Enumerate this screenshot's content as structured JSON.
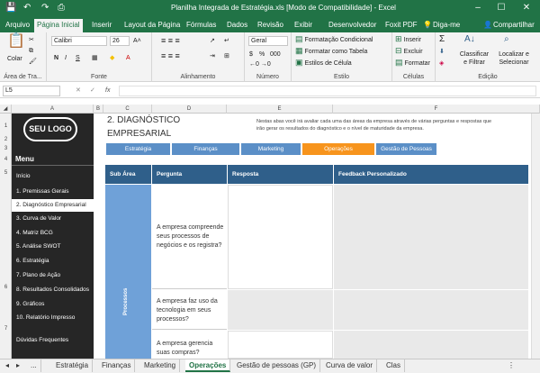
{
  "window": {
    "title": "Planilha Integrada de Estratégia.xls  [Modo de Compatibilidade] - Excel",
    "minimize": "–",
    "maximize": "☐",
    "close": "✕"
  },
  "ribbon_tabs": [
    "Arquivo",
    "Página Inicial",
    "Inserir",
    "Layout da Página",
    "Fórmulas",
    "Dados",
    "Revisão",
    "Exibir",
    "Desenvolvedor",
    "Foxit PDF",
    "Diga-me",
    "Compartilhar"
  ],
  "ribbon": {
    "clipboard": {
      "paste": "Colar",
      "label": "Área de Tra..."
    },
    "font": {
      "name": "Calibri",
      "size": "26",
      "bold": "N",
      "italic": "I",
      "underline": "S",
      "label": "Fonte"
    },
    "alignment": {
      "label": "Alinhamento"
    },
    "number": {
      "format": "Geral",
      "label": "Número",
      "percent": "%",
      "thousands": "000"
    },
    "styles": {
      "conditional": "Formatação Condicional",
      "table": "Formatar como Tabela",
      "cell": "Estilos de Célula",
      "label": "Estilo"
    },
    "cells": {
      "insert": "Inserir",
      "delete": "Excluir",
      "format": "Formatar",
      "label": "Células"
    },
    "editing": {
      "sort": "Classificar e Filtrar",
      "find": "Localizar e Selecionar",
      "label": "Edição"
    }
  },
  "formula_bar": {
    "name_box": "L5",
    "fx": "fx",
    "value": ""
  },
  "columns": [
    "A",
    "B",
    "C",
    "D",
    "E",
    "F"
  ],
  "rows": [
    "1",
    "2",
    "3",
    "4",
    "5",
    "6",
    "7"
  ],
  "sidebar": {
    "logo": "SEU LOGO",
    "menu": "Menu",
    "items": [
      "Início",
      "1. Premissas Gerais",
      "2. Diagnóstico Empresarial",
      "3. Curva de Valor",
      "4. Matriz BCG",
      "5. Análise SWOT",
      "6. Estratégia",
      "7. Plano de Ação",
      "8. Resultados Consolidados",
      "9. Gráficos",
      "10. Relatório Impresso",
      "Dúvidas Frequentes"
    ]
  },
  "main": {
    "title_line1": "2. DIAGNÓSTICO",
    "title_line2": "EMPRESARIAL",
    "description": "Nestas abas você irá avaliar cada uma das áreas da empresa através de várias perguntas e respostas que irão gerar os resultados do diagnóstico e o nível de maturidade da empresa.",
    "subtabs": [
      "Estratégia",
      "Finanças",
      "Marketing",
      "Operações",
      "Gestão de Pessoas"
    ],
    "headers": [
      "Sub Área",
      "Pergunta",
      "Resposta",
      "Feedback Personalizado"
    ],
    "sub_area": "Processos",
    "questions": [
      "A empresa compreende seus processos de negócios e os registra?",
      "A empresa faz uso da tecnologia em seus processos?",
      "A empresa gerencia suas compras?"
    ]
  },
  "sheet_tabs": [
    "...",
    "Estratégia",
    "Finanças",
    "Marketing",
    "Operações",
    "Gestão de pessoas (GP)",
    "Curva de valor",
    "Clas"
  ],
  "colors": {
    "excel_green": "#217346",
    "nav_dark": "#262626",
    "tab_blue": "#5b8fc7",
    "tab_active": "#f7941d",
    "header_blue": "#2f5f8a"
  }
}
